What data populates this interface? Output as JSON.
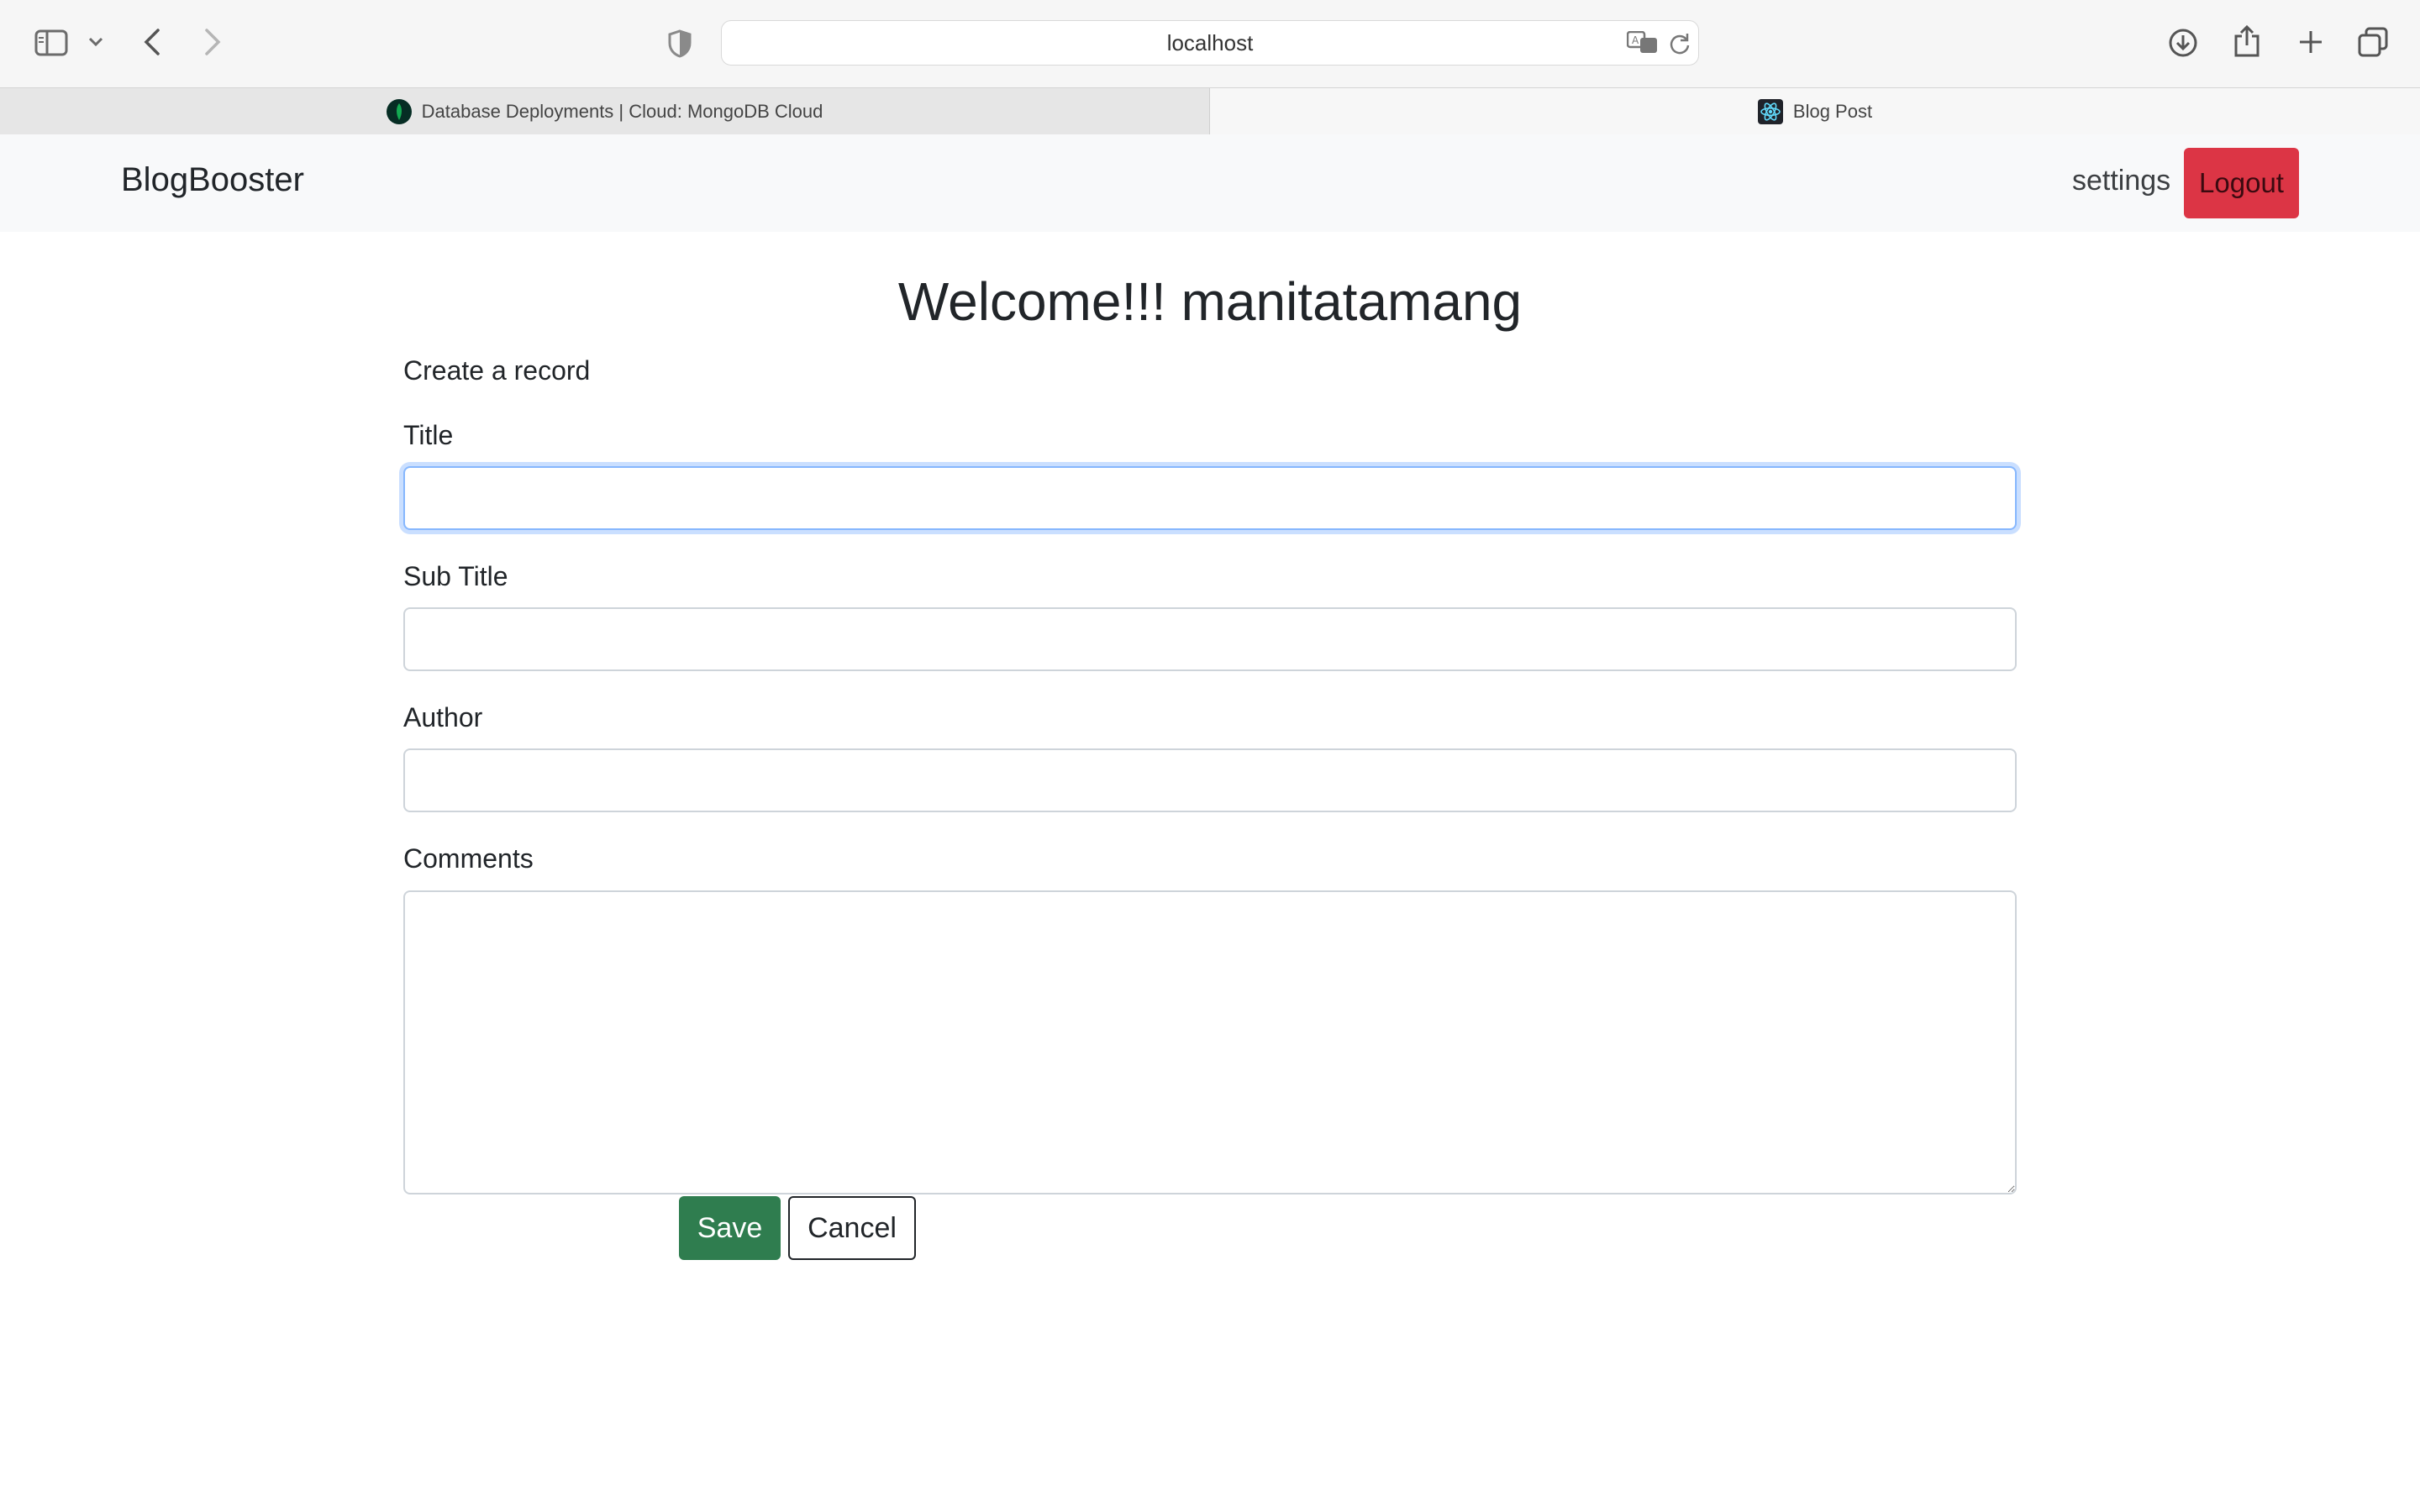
{
  "browser": {
    "url": "localhost",
    "tabs": [
      {
        "label": "Database Deployments | Cloud: MongoDB Cloud",
        "active": false,
        "icon": "mongodb-leaf-icon"
      },
      {
        "label": "Blog Post",
        "active": true,
        "icon": "react-atom-icon"
      }
    ],
    "toolbar_icons": [
      "sidebar-icon",
      "chevron-down-icon",
      "back-icon",
      "forward-icon",
      "privacy-shield-icon",
      "translate-icon",
      "reload-icon",
      "download-icon",
      "share-icon",
      "new-tab-icon",
      "tab-overview-icon"
    ]
  },
  "navbar": {
    "brand": "BlogBooster",
    "settings_label": "settings",
    "logout_label": "Logout"
  },
  "main": {
    "welcome": "Welcome!!! manitatamang",
    "section_label": "Create a record",
    "form": {
      "title_label": "Title",
      "title_value": "",
      "subtitle_label": "Sub Title",
      "subtitle_value": "",
      "author_label": "Author",
      "author_value": "",
      "comments_label": "Comments",
      "comments_value": "",
      "save_label": "Save",
      "cancel_label": "Cancel"
    }
  },
  "colors": {
    "logout_bg": "#dc3545",
    "save_bg": "#2f7d4f",
    "focus_ring": "#86b7fe",
    "navbar_bg": "#f8f9fa"
  }
}
